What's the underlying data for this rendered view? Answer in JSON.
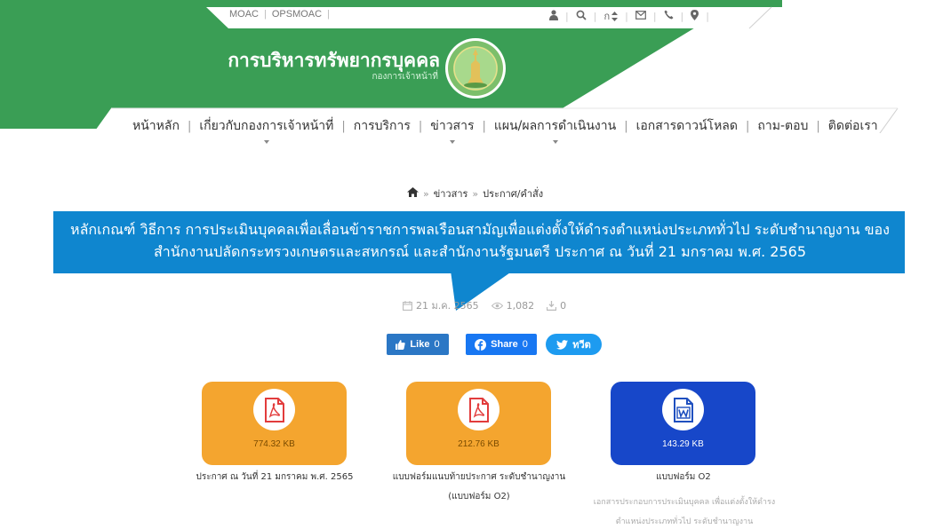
{
  "colors": {
    "green": "#3a9e55",
    "blue": "#0f86cf",
    "orange": "#f4a52f",
    "dark_blue": "#1747c9"
  },
  "topbar": {
    "links": [
      "MOAC",
      "OPSMOAC"
    ],
    "icons": [
      "user-icon",
      "search-icon",
      "font-size-icon",
      "mail-icon",
      "phone-icon",
      "map-pin-icon"
    ],
    "font_toggle": "ก"
  },
  "header": {
    "title": "การบริหารทรัพยากรบุคคล",
    "subtitle": "กองการเจ้าหน้าที่"
  },
  "nav": {
    "items": [
      {
        "label": "หน้าหลัก",
        "dropdown": false
      },
      {
        "label": "เกี่ยวกับกองการเจ้าหน้าที่",
        "dropdown": true
      },
      {
        "label": "การบริการ",
        "dropdown": false
      },
      {
        "label": "ข่าวสาร",
        "dropdown": true
      },
      {
        "label": "แผน/ผลการดำเนินงาน",
        "dropdown": true
      },
      {
        "label": "เอกสารดาวน์โหลด",
        "dropdown": false
      },
      {
        "label": "ถาม-ตอบ",
        "dropdown": false
      },
      {
        "label": "ติดต่อเรา",
        "dropdown": false
      }
    ]
  },
  "breadcrumb": {
    "items": [
      "ข่าวสาร",
      "ประกาศ/คำสั่ง"
    ]
  },
  "article": {
    "title_line1": "หลักเกณฑ์ วิธีการ การประเมินบุคคลเพื่อเลื่อนข้าราชการพลเรือนสามัญเพื่อแต่งตั้งให้ดำรงตำแหน่งประเภททั่วไป ระดับชำนาญงาน ของ",
    "title_line2": "สำนักงานปลัดกระทรวงเกษตรและสหกรณ์ และสำนักงานรัฐมนตรี ประกาศ ณ วันที่ 21 มกราคม พ.ศ. 2565",
    "date": "21 ม.ค. 2565",
    "views": "1,082",
    "downloads": "0"
  },
  "social": {
    "like_label": "Like",
    "like_count": "0",
    "share_label": "Share",
    "share_count": "0",
    "tweet_label": "ทวีต"
  },
  "files": [
    {
      "type": "pdf",
      "size": "774.32 KB",
      "caption": "ประกาศ ณ วันที่ 21 มกราคม พ.ศ. 2565",
      "caption2": "",
      "description": ""
    },
    {
      "type": "pdf",
      "size": "212.76 KB",
      "caption": "แบบฟอร์มแนบท้ายประกาศ ระดับชำนาญงาน",
      "caption2": "(แบบฟอร์ม O2)",
      "description": ""
    },
    {
      "type": "word",
      "size": "143.29 KB",
      "caption": "แบบฟอร์ม O2",
      "caption2": "",
      "description": "เอกสารประกอบการประเมินบุคคล เพื่อแต่งตั้งให้ดำรงตำแหน่งประเภททั่วไป ระดับชำนาญงาน"
    }
  ]
}
